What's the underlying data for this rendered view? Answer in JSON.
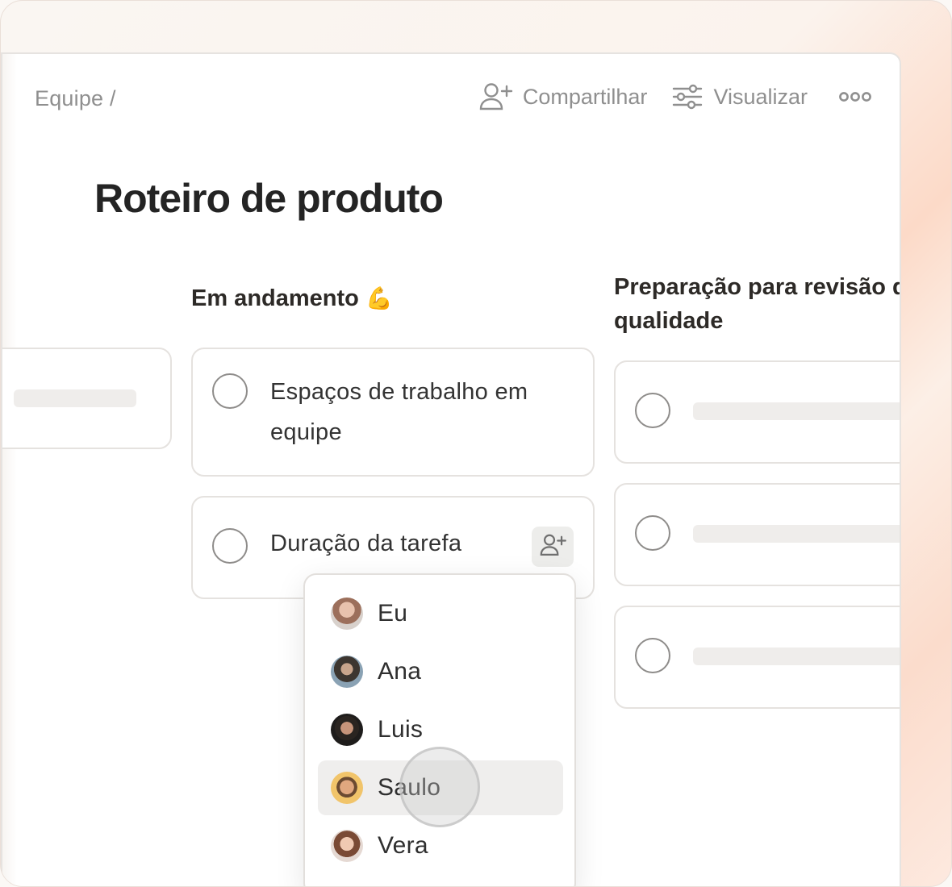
{
  "breadcrumb": "Equipe /",
  "toolbar": {
    "share_label": "Compartilhar",
    "view_label": "Visualizar"
  },
  "page_title": "Roteiro de produto",
  "columns": [
    {
      "title": "Em andamento",
      "emoji": "💪"
    },
    {
      "title_line1": "Preparação para revisão de",
      "title_line2": "qualidade"
    }
  ],
  "cards": [
    {
      "line1": "Espaços de trabalho em",
      "line2": "equipe"
    },
    {
      "text": "Duração da tarefa"
    }
  ],
  "assignees": [
    {
      "name": "Eu",
      "color": "#c99b84"
    },
    {
      "name": "Ana",
      "color": "#5d6d7a"
    },
    {
      "name": "Luis",
      "color": "#2d2a28"
    },
    {
      "name": "Saulo",
      "color": "#e9b35a",
      "highlighted": true
    },
    {
      "name": "Vera",
      "color": "#b97e63"
    }
  ],
  "colors": {
    "accent_bg": "#fcdac8",
    "muted_text": "#8f8f8f",
    "title_text": "#242424"
  }
}
